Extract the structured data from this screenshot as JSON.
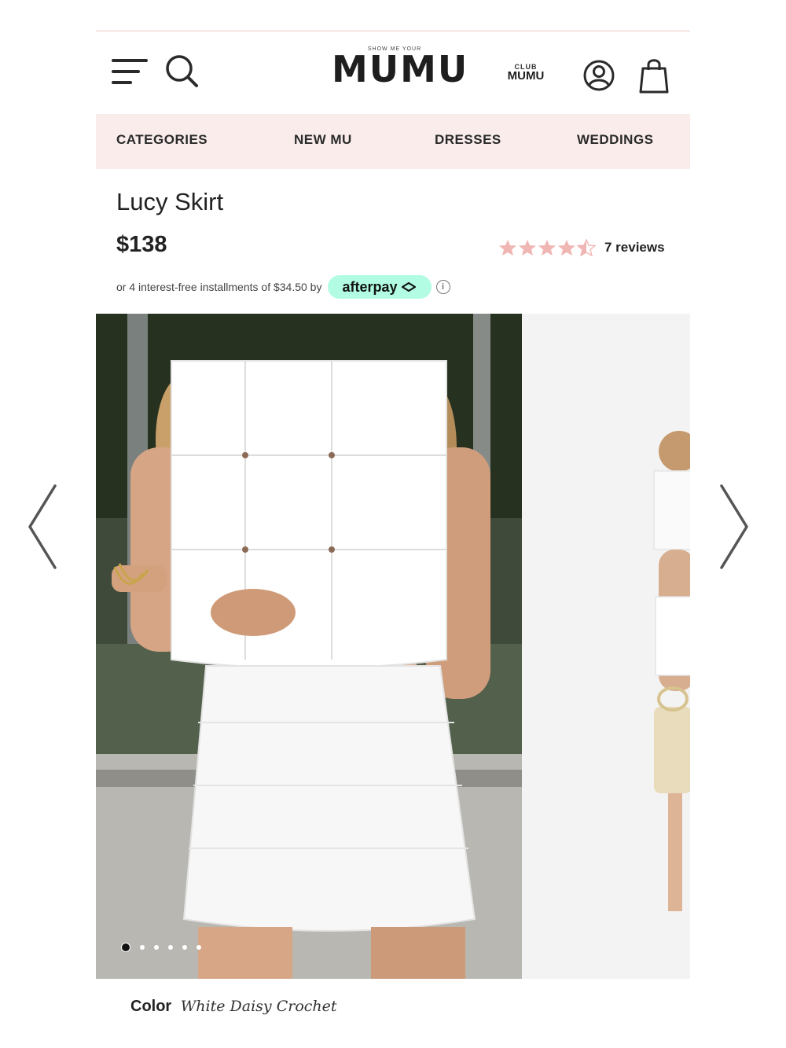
{
  "header": {
    "logo_tagline": "SHOW ME YOUR",
    "logo_text": "MUMU",
    "club_top": "CLUB",
    "club_main": "MUMU",
    "icons": [
      "menu-icon",
      "search-icon",
      "account-icon",
      "shopping-bag-icon"
    ]
  },
  "nav": {
    "items": [
      {
        "label": "CATEGORIES"
      },
      {
        "label": "NEW MU"
      },
      {
        "label": "DRESSES"
      },
      {
        "label": "WEDDINGS"
      }
    ]
  },
  "product": {
    "title": "Lucy Skirt",
    "price": "$138",
    "rating": 4.5,
    "reviews": "7 reviews",
    "installments_text": "or 4 interest-free installments of $34.50 by",
    "afterpay_label": "afterpay",
    "info_icon": "i",
    "color_label": "Color",
    "color_value": "White Daisy Crochet"
  },
  "gallery": {
    "image_count": 6,
    "active_index": 0
  },
  "colors": {
    "nav_bg": "#f9eceb",
    "star": "#f0b6b3",
    "afterpay": "#b2fce4"
  }
}
